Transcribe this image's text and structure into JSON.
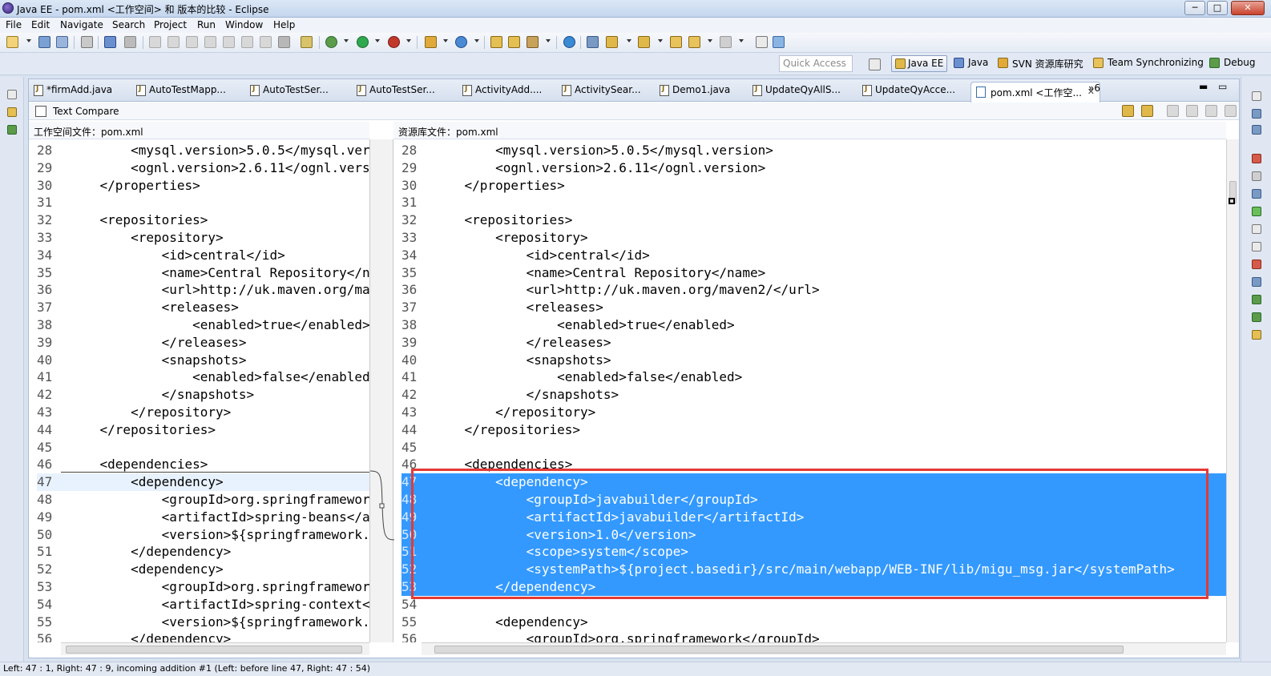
{
  "window": {
    "title": "Java EE - pom.xml <工作空间> 和 版本的比较 - Eclipse",
    "minimize": "─",
    "maximize": "□",
    "close": "✕"
  },
  "menu": [
    "File",
    "Edit",
    "Navigate",
    "Search",
    "Project",
    "Run",
    "Window",
    "Help"
  ],
  "perspectives": {
    "quick_access": "Quick Access",
    "items": [
      "Java EE",
      "Java",
      "SVN 资源库研究",
      "Team Synchronizing",
      "Debug"
    ]
  },
  "tabs": [
    "*firmAdd.java",
    "AutoTestMapp...",
    "AutoTestSer...",
    "AutoTestSer...",
    "ActivityAdd....",
    "ActivitySear...",
    "Demo1.java",
    "UpdateQyAllS...",
    "UpdateQyAcce...",
    "pom.xml <工作空..."
  ],
  "tab_overflow": "»6",
  "compare_title": "Text Compare",
  "left_pane": {
    "header": "工作空间文件：pom.xml",
    "lines": [
      {
        "n": "28",
        "t": "        <mysql.version>5.0.5</mysql.ver"
      },
      {
        "n": "29",
        "t": "        <ognl.version>2.6.11</ognl.vers"
      },
      {
        "n": "30",
        "t": "    </properties>"
      },
      {
        "n": "31",
        "t": ""
      },
      {
        "n": "32",
        "t": "    <repositories>"
      },
      {
        "n": "33",
        "t": "        <repository>"
      },
      {
        "n": "34",
        "t": "            <id>central</id>"
      },
      {
        "n": "35",
        "t": "            <name>Central Repository</n"
      },
      {
        "n": "36",
        "t": "            <url>http://uk.maven.org/ma"
      },
      {
        "n": "37",
        "t": "            <releases>"
      },
      {
        "n": "38",
        "t": "                <enabled>true</enabled>"
      },
      {
        "n": "39",
        "t": "            </releases>"
      },
      {
        "n": "40",
        "t": "            <snapshots>"
      },
      {
        "n": "41",
        "t": "                <enabled>false</enabled"
      },
      {
        "n": "42",
        "t": "            </snapshots>"
      },
      {
        "n": "43",
        "t": "        </repository>"
      },
      {
        "n": "44",
        "t": "    </repositories>"
      },
      {
        "n": "45",
        "t": ""
      },
      {
        "n": "46",
        "t": "    <dependencies>"
      },
      {
        "n": "47",
        "t": "        <dependency>"
      },
      {
        "n": "48",
        "t": "            <groupId>org.springframewor"
      },
      {
        "n": "49",
        "t": "            <artifactId>spring-beans</a"
      },
      {
        "n": "50",
        "t": "            <version>${springframework."
      },
      {
        "n": "51",
        "t": "        </dependency>"
      },
      {
        "n": "52",
        "t": "        <dependency>"
      },
      {
        "n": "53",
        "t": "            <groupId>org.springframewor"
      },
      {
        "n": "54",
        "t": "            <artifactId>spring-context<"
      },
      {
        "n": "55",
        "t": "            <version>${springframework."
      },
      {
        "n": "56",
        "t": "        </dependency>"
      }
    ]
  },
  "right_pane": {
    "header": "资源库文件：pom.xml",
    "lines": [
      {
        "n": "28",
        "t": "        <mysql.version>5.0.5</mysql.version>"
      },
      {
        "n": "29",
        "t": "        <ognl.version>2.6.11</ognl.version>"
      },
      {
        "n": "30",
        "t": "    </properties>"
      },
      {
        "n": "31",
        "t": ""
      },
      {
        "n": "32",
        "t": "    <repositories>"
      },
      {
        "n": "33",
        "t": "        <repository>"
      },
      {
        "n": "34",
        "t": "            <id>central</id>"
      },
      {
        "n": "35",
        "t": "            <name>Central Repository</name>"
      },
      {
        "n": "36",
        "t": "            <url>http://uk.maven.org/maven2/</url>"
      },
      {
        "n": "37",
        "t": "            <releases>"
      },
      {
        "n": "38",
        "t": "                <enabled>true</enabled>"
      },
      {
        "n": "39",
        "t": "            </releases>"
      },
      {
        "n": "40",
        "t": "            <snapshots>"
      },
      {
        "n": "41",
        "t": "                <enabled>false</enabled>"
      },
      {
        "n": "42",
        "t": "            </snapshots>"
      },
      {
        "n": "43",
        "t": "        </repository>"
      },
      {
        "n": "44",
        "t": "    </repositories>"
      },
      {
        "n": "45",
        "t": ""
      },
      {
        "n": "46",
        "t": "    <dependencies>"
      },
      {
        "n": "47",
        "t": "        <dependency> "
      },
      {
        "n": "48",
        "t": "            <groupId>javabuilder</groupId> "
      },
      {
        "n": "49",
        "t": "            <artifactId>javabuilder</artifactId> "
      },
      {
        "n": "50",
        "t": "            <version>1.0</version> "
      },
      {
        "n": "51",
        "t": "            <scope>system</scope> "
      },
      {
        "n": "52",
        "t": "            <systemPath>${project.basedir}/src/main/webapp/WEB-INF/lib/migu_msg.jar</systemPath> "
      },
      {
        "n": "53",
        "t": "        </dependency>"
      },
      {
        "n": "54",
        "t": ""
      },
      {
        "n": "55",
        "t": "        <dependency>"
      },
      {
        "n": "56",
        "t": "            <groupId>org.springframework</groupId>"
      }
    ]
  },
  "status": "Left: 47 : 1, Right: 47 : 9, incoming addition #1 (Left: before line 47, Right: 47 : 54)",
  "colors": {
    "selection": "#3399ff",
    "highlight_box": "#e53935",
    "current_line": "#e8f2fe"
  }
}
